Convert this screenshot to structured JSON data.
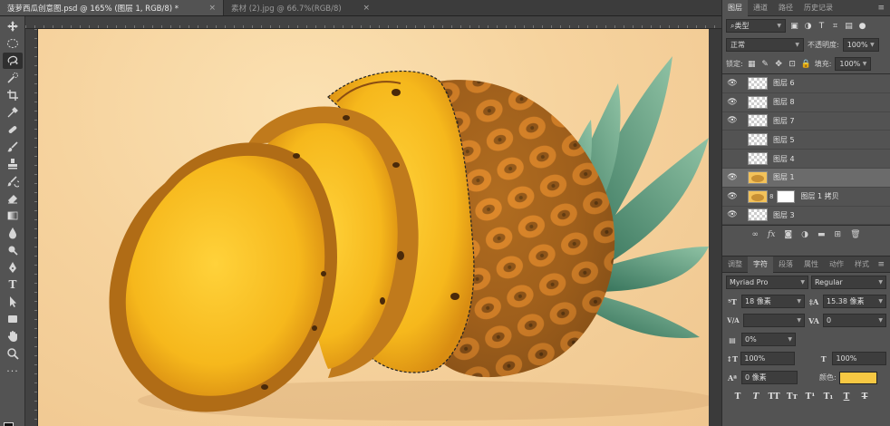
{
  "document_tabs": [
    {
      "label": "菠萝西瓜创意图.psd @ 165% (图层 1, RGB/8) *",
      "active": true
    },
    {
      "label": "素材 (2).jpg @ 66.7%(RGB/8)",
      "active": false
    }
  ],
  "tab_close_glyph": "×",
  "tools": [
    "move-icon",
    "marquee-icon",
    "lasso-icon",
    "quick-select-icon",
    "crop-icon",
    "eyedropper-icon",
    "healing-icon",
    "brush-icon",
    "stamp-icon",
    "history-brush-icon",
    "eraser-icon",
    "gradient-icon",
    "blur-icon",
    "dodge-icon",
    "pen-icon",
    "type-icon",
    "path-select-icon",
    "shape-icon",
    "hand-icon",
    "zoom-icon",
    "more-tools-icon"
  ],
  "colors": {
    "foreground": "#111111",
    "background": "#f6c344",
    "canvas_bg": "#f6d39e",
    "panel": "#535353"
  },
  "layers_panel": {
    "tabs": [
      "图层",
      "通道",
      "路径",
      "历史记录"
    ],
    "filter_kind": "类型",
    "blend_mode": "正常",
    "opacity_label": "不透明度:",
    "opacity": "100%",
    "lock_label": "锁定:",
    "fill_label": "填充:",
    "fill": "100%",
    "layers": [
      {
        "name": "图层 6",
        "visible": true,
        "selected": false,
        "thumb": "empty"
      },
      {
        "name": "图层 8",
        "visible": true,
        "selected": false,
        "thumb": "empty"
      },
      {
        "name": "图层 7",
        "visible": true,
        "selected": false,
        "thumb": "empty"
      },
      {
        "name": "图层 5",
        "visible": false,
        "selected": false,
        "thumb": "empty"
      },
      {
        "name": "图层 4",
        "visible": false,
        "selected": false,
        "thumb": "empty"
      },
      {
        "name": "图层 1",
        "visible": true,
        "selected": true,
        "thumb": "pine"
      },
      {
        "name": "图层 1 拷贝",
        "visible": true,
        "selected": false,
        "thumb": "pine-mask"
      },
      {
        "name": "图层 3",
        "visible": true,
        "selected": false,
        "thumb": "empty"
      }
    ]
  },
  "character_panel": {
    "tabs": [
      "调整",
      "字符",
      "段落",
      "属性",
      "动作",
      "样式"
    ],
    "font_family": "Myriad Pro",
    "font_style": "Regular",
    "font_size": "18 像素",
    "leading": "15.38 像素",
    "kerning_label": "V/A",
    "tracking": "0",
    "tsume": "0%",
    "vertical_scale": "100%",
    "horizontal_scale": "100%",
    "baseline_shift": "0 像素",
    "color_label": "颜色:",
    "text_color": "#f7c843",
    "style_buttons": [
      "T",
      "T",
      "TT",
      "Tт",
      "T¹",
      "T₁",
      "T",
      "T"
    ]
  }
}
